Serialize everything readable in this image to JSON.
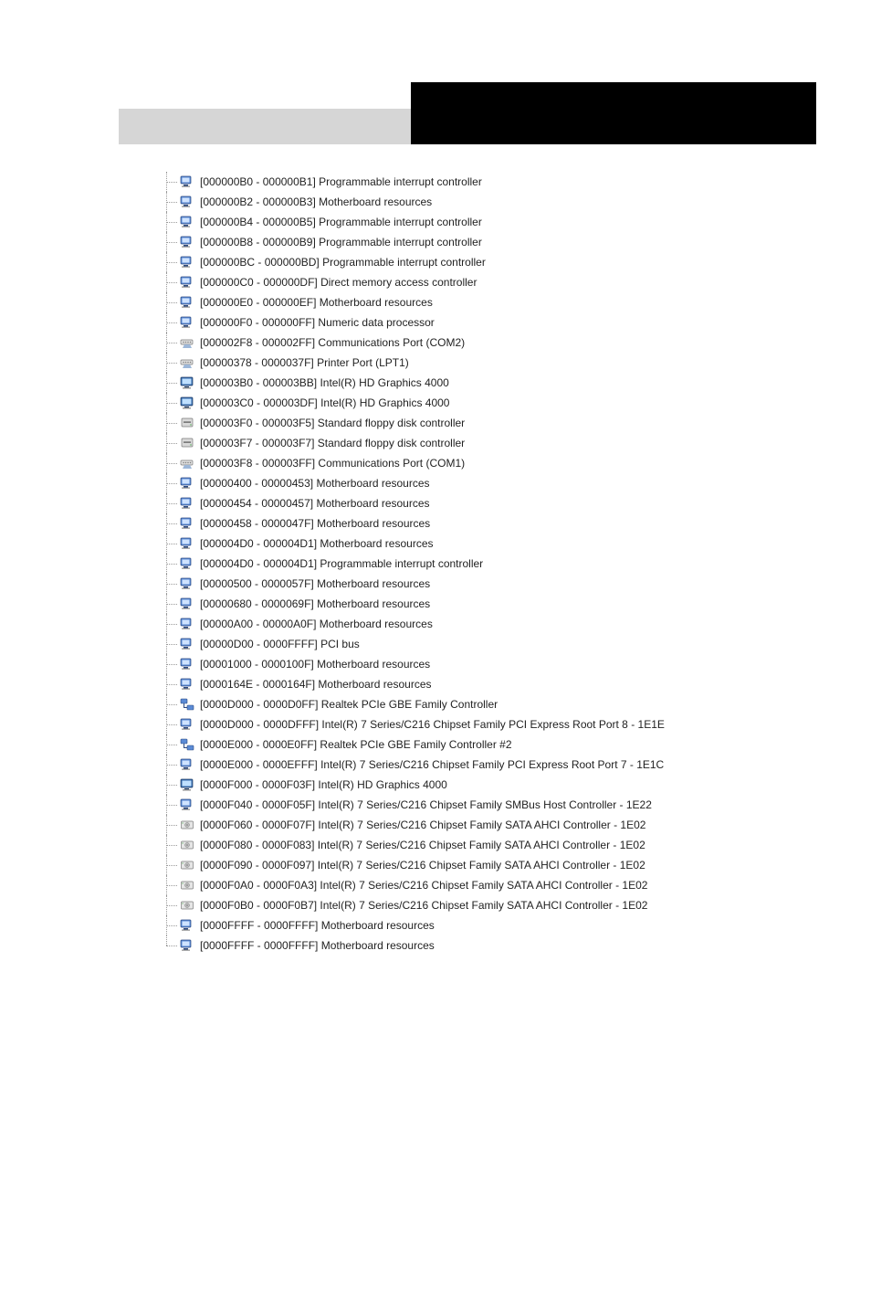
{
  "tree": [
    {
      "icon": "computer",
      "range": "[000000B0 - 000000B1]",
      "label": "Programmable interrupt controller"
    },
    {
      "icon": "computer",
      "range": "[000000B2 - 000000B3]",
      "label": "Motherboard resources"
    },
    {
      "icon": "computer",
      "range": "[000000B4 - 000000B5]",
      "label": "Programmable interrupt controller"
    },
    {
      "icon": "computer",
      "range": "[000000B8 - 000000B9]",
      "label": "Programmable interrupt controller"
    },
    {
      "icon": "computer",
      "range": "[000000BC - 000000BD]",
      "label": "Programmable interrupt controller"
    },
    {
      "icon": "computer",
      "range": "[000000C0 - 000000DF]",
      "label": "Direct memory access controller"
    },
    {
      "icon": "computer",
      "range": "[000000E0 - 000000EF]",
      "label": "Motherboard resources"
    },
    {
      "icon": "computer",
      "range": "[000000F0 - 000000FF]",
      "label": "Numeric data processor"
    },
    {
      "icon": "port",
      "range": "[000002F8 - 000002FF]",
      "label": "Communications Port (COM2)"
    },
    {
      "icon": "port",
      "range": "[00000378 - 0000037F]",
      "label": "Printer Port (LPT1)"
    },
    {
      "icon": "display",
      "range": "[000003B0 - 000003BB]",
      "label": "Intel(R) HD Graphics 4000"
    },
    {
      "icon": "display",
      "range": "[000003C0 - 000003DF]",
      "label": "Intel(R) HD Graphics 4000"
    },
    {
      "icon": "floppy",
      "range": "[000003F0 - 000003F5]",
      "label": "Standard floppy disk controller"
    },
    {
      "icon": "floppy",
      "range": "[000003F7 - 000003F7]",
      "label": "Standard floppy disk controller"
    },
    {
      "icon": "port",
      "range": "[000003F8 - 000003FF]",
      "label": "Communications Port (COM1)"
    },
    {
      "icon": "computer",
      "range": "[00000400 - 00000453]",
      "label": "Motherboard resources"
    },
    {
      "icon": "computer",
      "range": "[00000454 - 00000457]",
      "label": "Motherboard resources"
    },
    {
      "icon": "computer",
      "range": "[00000458 - 0000047F]",
      "label": "Motherboard resources"
    },
    {
      "icon": "computer",
      "range": "[000004D0 - 000004D1]",
      "label": "Motherboard resources"
    },
    {
      "icon": "computer",
      "range": "[000004D0 - 000004D1]",
      "label": "Programmable interrupt controller"
    },
    {
      "icon": "computer",
      "range": "[00000500 - 0000057F]",
      "label": "Motherboard resources"
    },
    {
      "icon": "computer",
      "range": "[00000680 - 0000069F]",
      "label": "Motherboard resources"
    },
    {
      "icon": "computer",
      "range": "[00000A00 - 00000A0F]",
      "label": "Motherboard resources"
    },
    {
      "icon": "computer",
      "range": "[00000D00 - 0000FFFF]",
      "label": "PCI bus"
    },
    {
      "icon": "computer",
      "range": "[00001000 - 0000100F]",
      "label": "Motherboard resources"
    },
    {
      "icon": "computer",
      "range": "[0000164E - 0000164F]",
      "label": "Motherboard resources"
    },
    {
      "icon": "network",
      "range": "[0000D000 - 0000D0FF]",
      "label": "Realtek PCIe GBE Family Controller"
    },
    {
      "icon": "computer",
      "range": "[0000D000 - 0000DFFF]",
      "label": "Intel(R) 7 Series/C216 Chipset Family PCI Express Root Port 8 - 1E1E"
    },
    {
      "icon": "network",
      "range": "[0000E000 - 0000E0FF]",
      "label": "Realtek PCIe GBE Family Controller #2"
    },
    {
      "icon": "computer",
      "range": "[0000E000 - 0000EFFF]",
      "label": "Intel(R) 7 Series/C216 Chipset Family PCI Express Root Port 7 - 1E1C"
    },
    {
      "icon": "display",
      "range": "[0000F000 - 0000F03F]",
      "label": "Intel(R) HD Graphics 4000"
    },
    {
      "icon": "computer",
      "range": "[0000F040 - 0000F05F]",
      "label": "Intel(R) 7 Series/C216 Chipset Family SMBus Host Controller - 1E22"
    },
    {
      "icon": "storage",
      "range": "[0000F060 - 0000F07F]",
      "label": "Intel(R) 7 Series/C216 Chipset Family SATA AHCI Controller - 1E02"
    },
    {
      "icon": "storage",
      "range": "[0000F080 - 0000F083]",
      "label": "Intel(R) 7 Series/C216 Chipset Family SATA AHCI Controller - 1E02"
    },
    {
      "icon": "storage",
      "range": "[0000F090 - 0000F097]",
      "label": "Intel(R) 7 Series/C216 Chipset Family SATA AHCI Controller - 1E02"
    },
    {
      "icon": "storage",
      "range": "[0000F0A0 - 0000F0A3]",
      "label": "Intel(R) 7 Series/C216 Chipset Family SATA AHCI Controller - 1E02"
    },
    {
      "icon": "storage",
      "range": "[0000F0B0 - 0000F0B7]",
      "label": "Intel(R) 7 Series/C216 Chipset Family SATA AHCI Controller - 1E02"
    },
    {
      "icon": "computer",
      "range": "[0000FFFF - 0000FFFF]",
      "label": "Motherboard resources"
    },
    {
      "icon": "computer",
      "range": "[0000FFFF - 0000FFFF]",
      "label": "Motherboard resources"
    }
  ]
}
